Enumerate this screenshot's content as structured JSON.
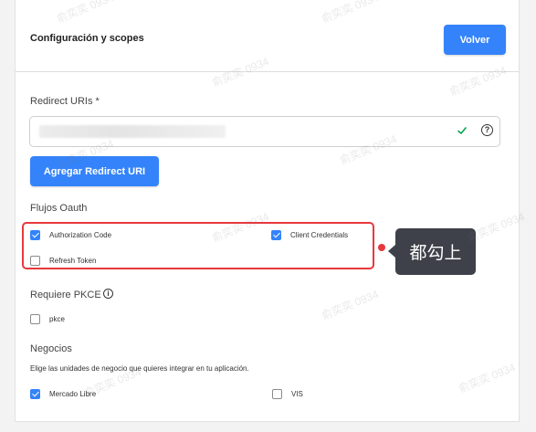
{
  "header": {
    "title": "Configuración y scopes",
    "back_label": "Volver"
  },
  "redirect": {
    "label": "Redirect URIs *",
    "value_icon": "check-icon",
    "help_icon": "question-circle-icon",
    "add_label": "Agregar Redirect URI"
  },
  "oauth": {
    "title": "Flujos Oauth",
    "options": [
      {
        "label": "Authorization Code",
        "checked": true
      },
      {
        "label": "Client Credentials",
        "checked": true
      },
      {
        "label": "Refresh Token",
        "checked": false
      }
    ]
  },
  "pkce": {
    "title": "Requiere PKCE",
    "info_icon": "info-icon",
    "option_label": "pkce",
    "checked": false
  },
  "business": {
    "title": "Negocios",
    "description": "Elige las unidades de negocio que quieres integrar en tu aplicación.",
    "options": [
      {
        "label": "Mercado Libre",
        "checked": true
      },
      {
        "label": "VIS",
        "checked": false
      }
    ]
  },
  "annotation": {
    "text": "都勾上"
  },
  "watermark": {
    "text": "俞奕奕 0934"
  },
  "colors": {
    "accent": "#3483fa",
    "highlight": "#e8383d",
    "callout_bg": "#3e4149"
  }
}
